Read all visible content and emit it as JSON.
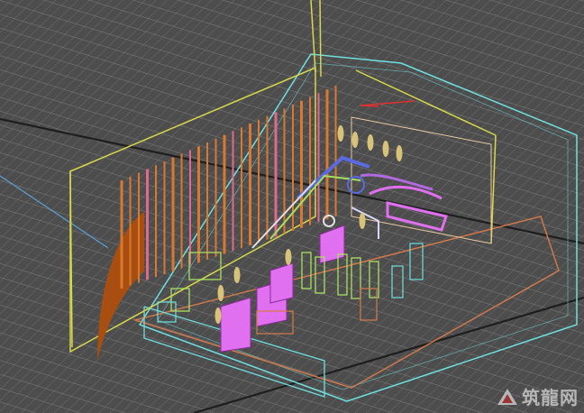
{
  "viewport": {
    "background_color": "#4d4d4d",
    "grid_color": "#7a7a7a",
    "axis_line_color": "#1e1e1e"
  },
  "wireframe_colors": {
    "frame_yellow": "#d8d84a",
    "frame_cyan": "#6fe0e0",
    "frame_orange": "#d77a4a",
    "curved_wall": "#a84e10",
    "column_orange": "#d9782e",
    "column_pink": "#e06a8a",
    "panel_magenta": "#e070f0",
    "panel_green": "#a8e060",
    "figure_tan": "#d7c27a",
    "machine_blue": "#5a6ae0",
    "red_axis": "#e03030"
  },
  "icons": [
    "zhulong-logo-icon"
  ],
  "watermark": {
    "text": "筑龍网"
  }
}
